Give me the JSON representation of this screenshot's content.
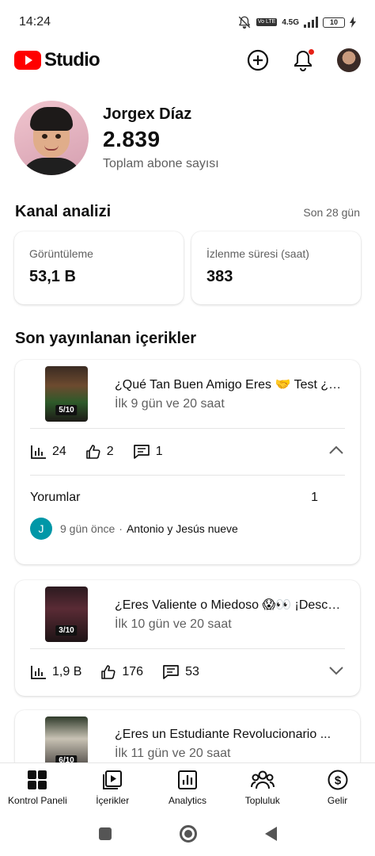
{
  "status_bar": {
    "time": "14:24",
    "network": "4.5G",
    "volte": "Vo LTE",
    "battery": "10"
  },
  "header": {
    "app_name": "Studio",
    "icons": [
      "create-icon",
      "bell-icon",
      "account-avatar"
    ]
  },
  "channel": {
    "name": "Jorgex Díaz",
    "subscribers": "2.839",
    "subscribers_label": "Toplam abone sayısı"
  },
  "analytics": {
    "title": "Kanal analizi",
    "period": "Son 28 gün",
    "metrics": [
      {
        "label": "Görüntüleme",
        "value": "53,1 B"
      },
      {
        "label": "İzlenme süresi (saat)",
        "value": "383"
      }
    ]
  },
  "recent": {
    "title": "Son yayınlanan içerikler",
    "videos": [
      {
        "title": "¿Qué Tan Buen Amigo Eres 🤝 Test ¿Es Tu Amigo...",
        "age": "İlk 9 gün ve 20 saat",
        "thumb_badge": "5/10",
        "views": "24",
        "likes": "2",
        "comments": "1",
        "expanded": true,
        "comments_label": "Yorumlar",
        "comments_count": "1",
        "latest_comment": {
          "initial": "J",
          "time": "9 gün önce",
          "text": "Antonio y Jesús nueve"
        }
      },
      {
        "title": "¿Eres Valiente o Miedoso 😱👀 ¡Descúbrelo!",
        "age": "İlk 10 gün ve 20 saat",
        "thumb_badge": "3/10",
        "views": "1,9 B",
        "likes": "176",
        "comments": "53",
        "expanded": false
      },
      {
        "title": "¿Eres un Estudiante Revolucionario ...",
        "age": "İlk 11 gün ve 20 saat",
        "thumb_badge": "6/10"
      }
    ]
  },
  "bottom_nav": [
    {
      "label": "Kontrol Paneli",
      "icon": "dashboard-icon"
    },
    {
      "label": "İçerikler",
      "icon": "content-icon"
    },
    {
      "label": "Analytics",
      "icon": "analytics-icon"
    },
    {
      "label": "Topluluk",
      "icon": "community-icon"
    },
    {
      "label": "Gelir",
      "icon": "earn-icon"
    }
  ],
  "colors": {
    "brand": "#ff0000",
    "text": "#0f0f0f",
    "secondary": "#606060",
    "comment_avatar": "#0097a7",
    "notification_dot": "#e62117"
  }
}
